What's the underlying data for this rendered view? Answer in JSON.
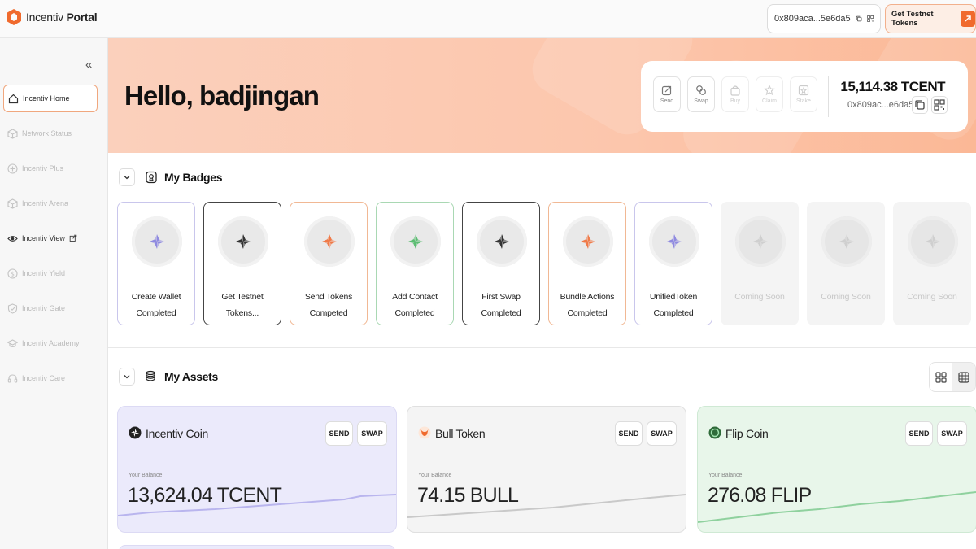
{
  "app": {
    "brand_prefix": "Incentiv",
    "brand_suffix": "Portal",
    "wallet_short": "0x809aca...5e6da5",
    "testnet_button": "Get Testnet Tokens",
    "accent_color": "#f06a2d"
  },
  "sidebar": {
    "collapse_glyph": "«",
    "items": [
      {
        "label": "Incentiv Home",
        "icon": "home-icon",
        "active": true
      },
      {
        "label": "Network Status",
        "icon": "cube-icon",
        "active": false
      },
      {
        "label": "Incentiv Plus",
        "icon": "plus-circle-icon",
        "active": false
      },
      {
        "label": "Incentiv Arena",
        "icon": "cube-icon",
        "active": false
      },
      {
        "label": "Incentiv View",
        "icon": "eye-icon",
        "active": false,
        "external": true
      },
      {
        "label": "Incentiv Yield",
        "icon": "dollar-icon",
        "active": false
      },
      {
        "label": "Incentiv Gate",
        "icon": "shield-icon",
        "active": false
      },
      {
        "label": "Incentiv Academy",
        "icon": "graduation-icon",
        "active": false
      },
      {
        "label": "Incentiv Care",
        "icon": "headset-icon",
        "active": false
      }
    ]
  },
  "hero": {
    "greeting": "Hello, badjingan",
    "actions": [
      {
        "label": "Send",
        "icon": "send-icon",
        "enabled": true
      },
      {
        "label": "Swap",
        "icon": "swap-icon",
        "enabled": true
      },
      {
        "label": "Buy",
        "icon": "bag-icon",
        "enabled": false
      },
      {
        "label": "Claim",
        "icon": "claim-icon",
        "enabled": false
      },
      {
        "label": "Stake",
        "icon": "stake-icon",
        "enabled": false
      }
    ],
    "balance": "15,114.38 TCENT",
    "address": "0x809ac...e6da5"
  },
  "badges": {
    "title": "My Badges",
    "items": [
      {
        "line1": "Create Wallet",
        "line2": "Completed",
        "border": "#c9c6ec",
        "icon_color": "#8f8ae0"
      },
      {
        "line1": "Get Testnet",
        "line2": "Tokens...",
        "border": "#444444",
        "icon_color": "#333333"
      },
      {
        "line1": "Send Tokens",
        "line2": "Competed",
        "border": "#f1b894",
        "icon_color": "#f07a48"
      },
      {
        "line1": "Add Contact",
        "line2": "Completed",
        "border": "#a9d8b3",
        "icon_color": "#5cbd73"
      },
      {
        "line1": "First Swap",
        "line2": "Completed",
        "border": "#444444",
        "icon_color": "#333333"
      },
      {
        "line1": "Bundle Actions",
        "line2": "Completed",
        "border": "#f1b894",
        "icon_color": "#f07a48"
      },
      {
        "line1": "UnifiedToken",
        "line2": "Completed",
        "border": "#c9c6ec",
        "icon_color": "#8f8ae0"
      },
      {
        "line1": "Coming Soon",
        "line2": "",
        "soon": true
      },
      {
        "line1": "Coming Soon",
        "line2": "",
        "soon": true
      },
      {
        "line1": "Coming Soon",
        "line2": "",
        "soon": true
      }
    ]
  },
  "assets": {
    "title": "My Assets",
    "balance_label": "Your Balance",
    "send_label": "SEND",
    "swap_label": "SWAP",
    "items": [
      {
        "name": "Incentiv Coin",
        "amount": "13,624.04 TCENT",
        "theme": "purple",
        "line_color": "#b9b5ee",
        "icon": "incentiv-coin-icon"
      },
      {
        "name": "Bull Token",
        "amount": "74.15 BULL",
        "theme": "grey",
        "line_color": "#c9c9c9",
        "icon": "bull-token-icon"
      },
      {
        "name": "Flip Coin",
        "amount": "276.08 FLIP",
        "theme": "green",
        "line_color": "#8fd19e",
        "icon": "flip-coin-icon"
      }
    ]
  }
}
